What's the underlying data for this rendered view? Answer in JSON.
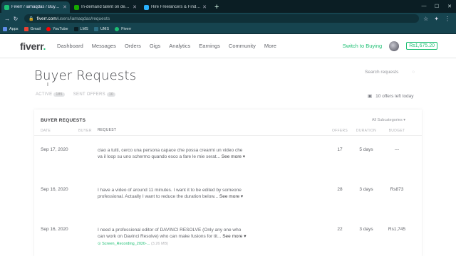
{
  "browser": {
    "tabs": [
      {
        "title": "Fiverr / iamaqdas / Buyer Reque...",
        "active": true,
        "fav_color": "#1dbf73"
      },
      {
        "title": "In-demand talent on demand.™",
        "active": false,
        "fav_color": "#14a800"
      },
      {
        "title": "Hire Freelancers & Find Freelanc...",
        "active": false,
        "fav_color": "#29b2fe"
      }
    ],
    "new_tab": "+",
    "url_host": "fiverr.com",
    "url_path": "/users/iamaqdas/requests",
    "bookmarks": [
      {
        "label": "Apps",
        "color": "#5f8de8"
      },
      {
        "label": "Gmail",
        "color": "#ea4335"
      },
      {
        "label": "YouTube",
        "color": "#ff0000"
      },
      {
        "label": "LMS",
        "color": "#16444f"
      },
      {
        "label": "UMS",
        "color": "#2c6d82"
      },
      {
        "label": "Fiverr",
        "color": "#1dbf73"
      }
    ]
  },
  "header": {
    "logo": "fiverr",
    "logo_dot": ".",
    "nav": [
      "Dashboard",
      "Messages",
      "Orders",
      "Gigs",
      "Analytics",
      "Earnings",
      "Community",
      "More"
    ],
    "switch": "Switch to Buying",
    "balance": "Rs1,675.20"
  },
  "page": {
    "title": "Buyer Requests",
    "search_placeholder": "Search requests",
    "tab_active": {
      "label": "ACTIVE",
      "count": "185"
    },
    "tab_sent": {
      "label": "SENT OFFERS",
      "count": "10"
    },
    "offers_left": "10 offers left today"
  },
  "table": {
    "heading": "BUYER REQUESTS",
    "filter": "All Subcategories",
    "columns": {
      "date": "DATE",
      "buyer": "BUYER",
      "request": "REQUEST",
      "offers": "OFFERS",
      "duration": "DURATION",
      "budget": "BUDGET"
    },
    "rows": [
      {
        "date": "Sep 17, 2020",
        "line1": "ciao a tutti, cerco una persona capace che possa crearmi un video che",
        "line2": "va il loop su uno schermo quando esco a fare le mie serat...",
        "more": "See more",
        "attachment": "",
        "attach_size": "",
        "offers": "17",
        "duration": "5 days",
        "budget": "---"
      },
      {
        "date": "Sep 16, 2020",
        "line1": "I have a video of around 11 minutes. I want it to be edited by someone",
        "line2": "professional. Actually I want to reduce the duration below...",
        "more": "See more",
        "attachment": "",
        "attach_size": "",
        "offers": "28",
        "duration": "3 days",
        "budget": "Rs873"
      },
      {
        "date": "Sep 16, 2020",
        "line1": "I need a professional editor of DAVINCI RESOLVE (Only any one who",
        "line2": "can work on Davinci Resolve) who can make fusions for tit...",
        "more": "See more",
        "attachment": "Screen_Recording_2020-...",
        "attach_size": "(3.26 MB)",
        "offers": "22",
        "duration": "3 days",
        "budget": "Rs1,745"
      }
    ]
  }
}
